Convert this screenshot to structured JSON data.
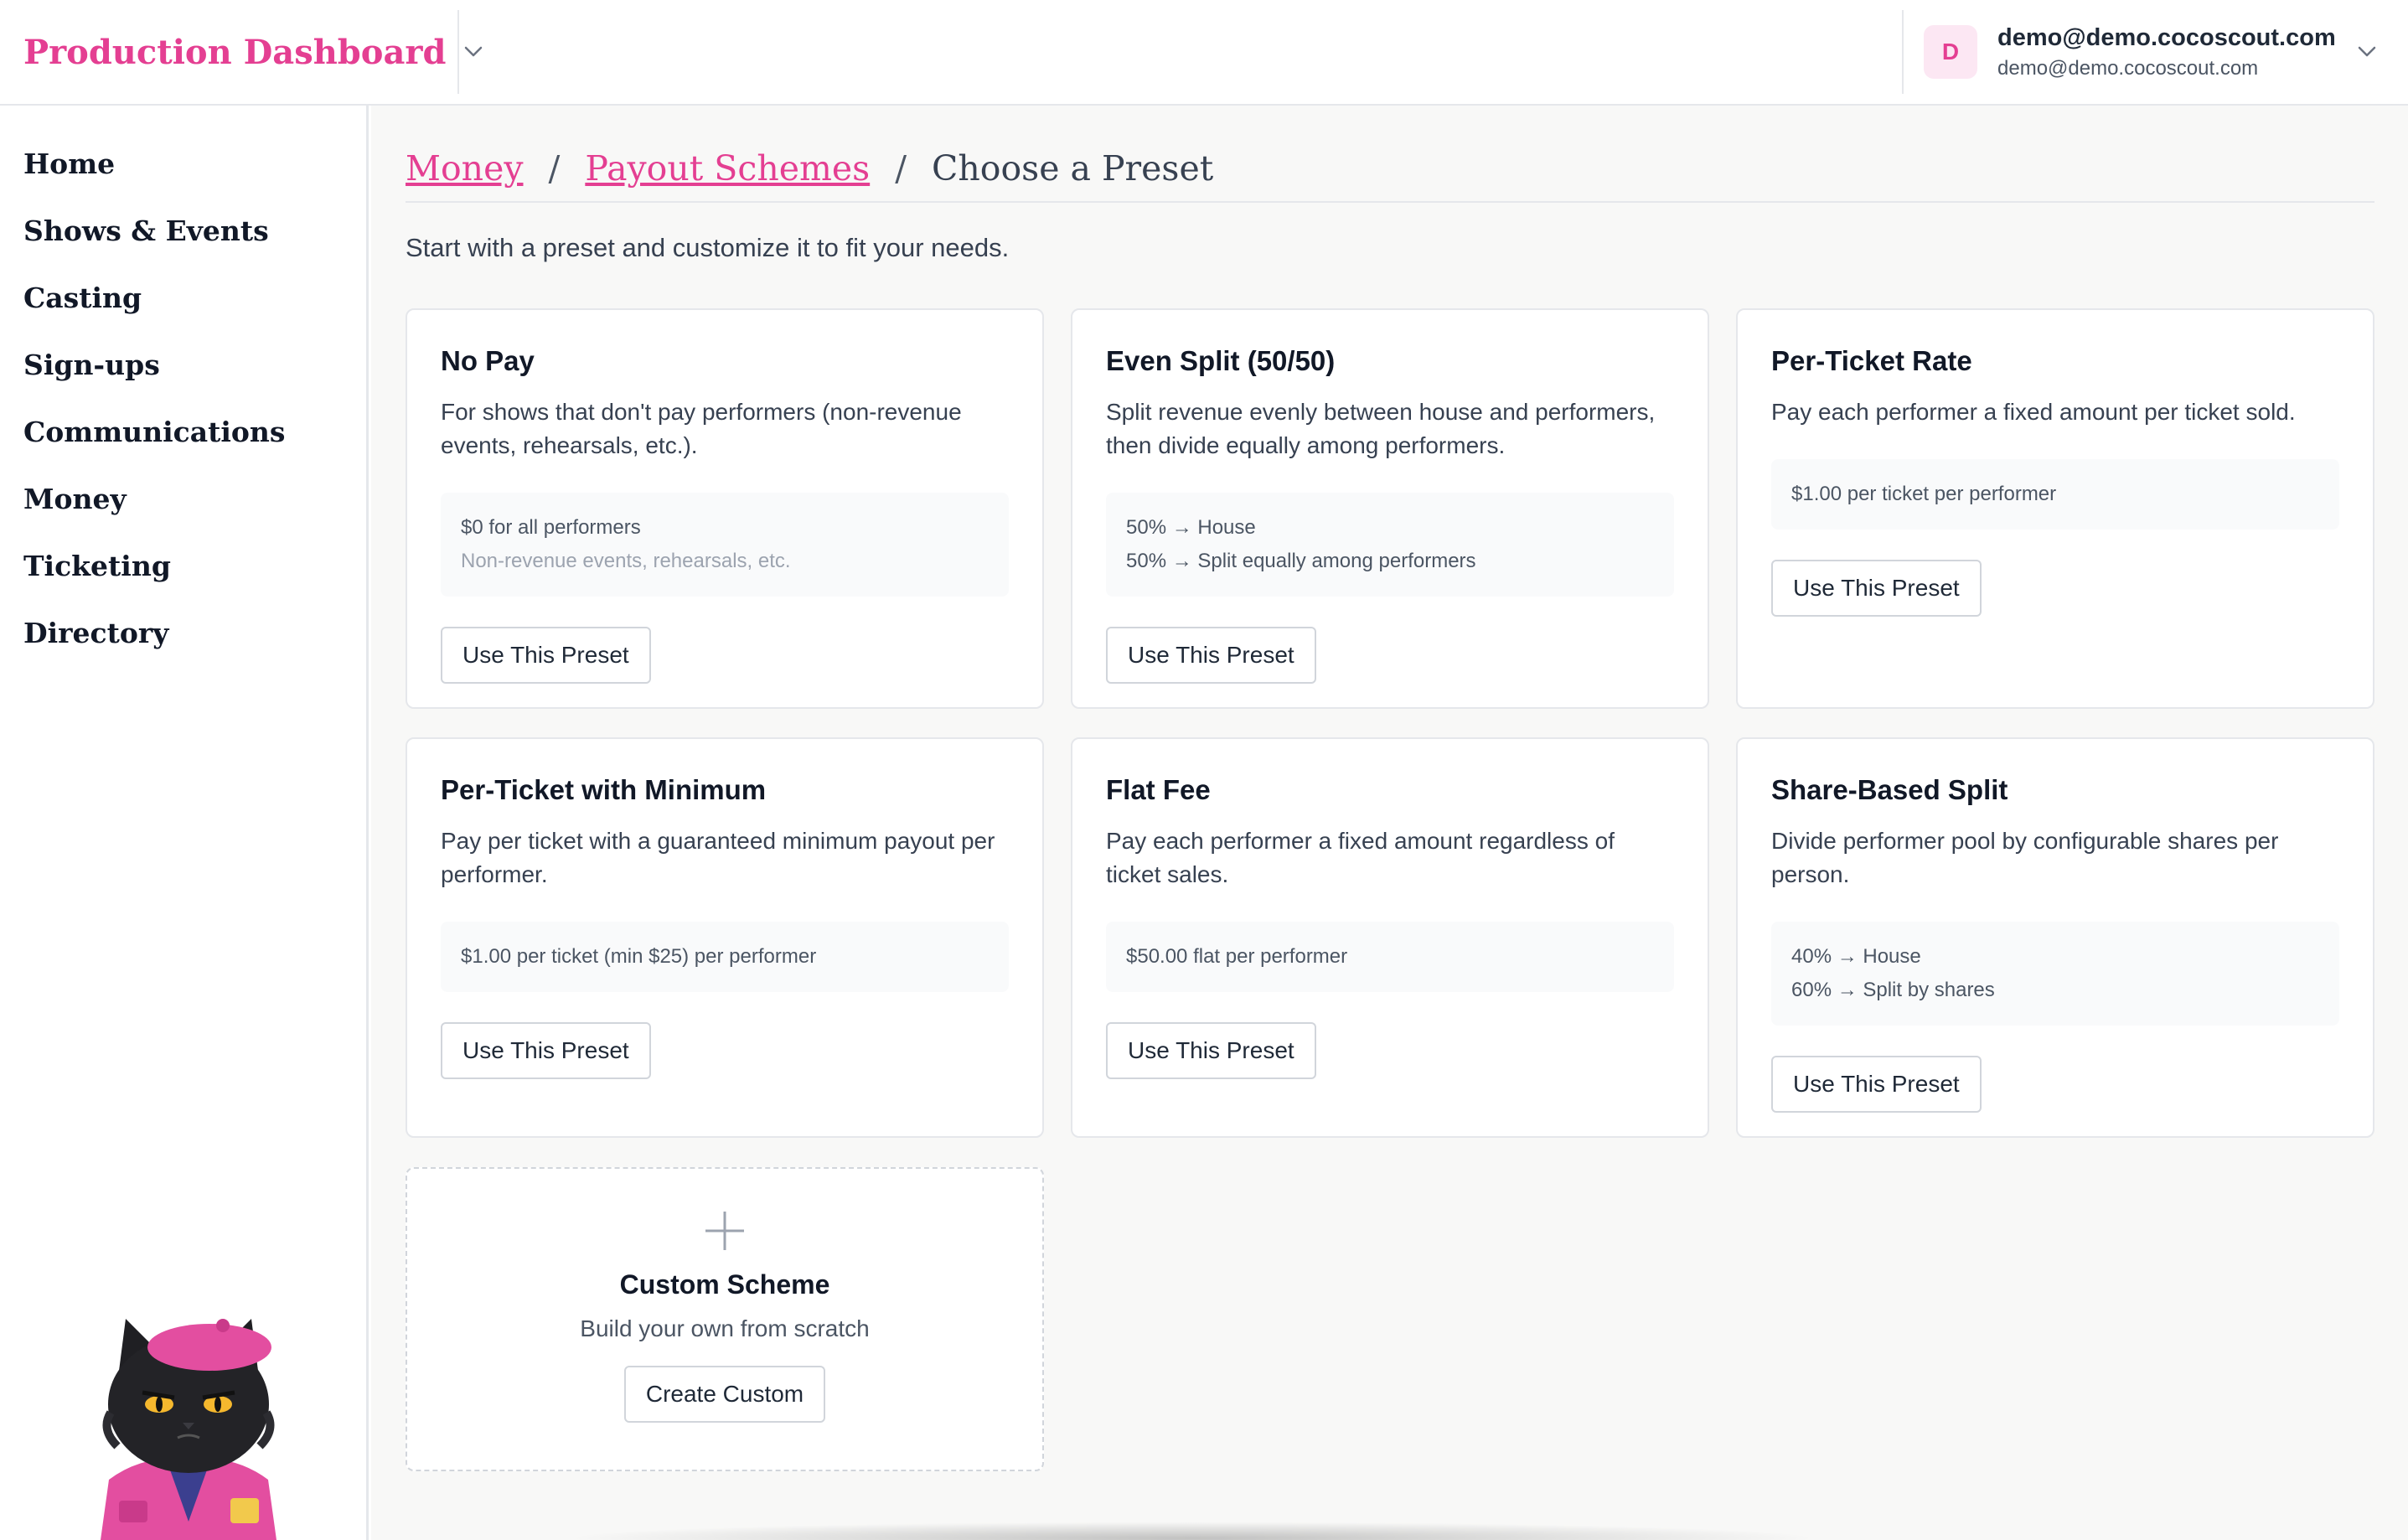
{
  "colors": {
    "brand": "#e43f92",
    "avatar_bg": "#fce7f3"
  },
  "header": {
    "brand_title": "Production Dashboard",
    "account": {
      "avatar_letter": "D",
      "name": "demo@demo.cocoscout.com",
      "email": "demo@demo.cocoscout.com"
    }
  },
  "sidebar": {
    "items": [
      {
        "label": "Home"
      },
      {
        "label": "Shows & Events"
      },
      {
        "label": "Casting"
      },
      {
        "label": "Sign-ups"
      },
      {
        "label": "Communications"
      },
      {
        "label": "Money"
      },
      {
        "label": "Ticketing"
      },
      {
        "label": "Directory"
      }
    ]
  },
  "breadcrumb": {
    "items": [
      {
        "label": "Money"
      },
      {
        "label": "Payout Schemes"
      }
    ],
    "separator": "/",
    "current": "Choose a Preset"
  },
  "intro": "Start with a preset and customize it to fit your needs.",
  "presets": [
    {
      "title": "No Pay",
      "description": "For shows that don't pay performers (non-revenue events, rehearsals, etc.).",
      "lines": [
        "$0 for all performers",
        "Non-revenue events, rehearsals, etc."
      ],
      "button": "Use This Preset"
    },
    {
      "title": "Even Split (50/50)",
      "description": "Split revenue evenly between house and performers, then divide equally among performers.",
      "lines": [
        "50% → House",
        "50% → Split equally among performers"
      ],
      "button": "Use This Preset"
    },
    {
      "title": "Per-Ticket Rate",
      "description": "Pay each performer a fixed amount per ticket sold.",
      "lines": [
        "$1.00 per ticket per performer"
      ],
      "button": "Use This Preset"
    },
    {
      "title": "Per-Ticket with Minimum",
      "description": "Pay per ticket with a guaranteed minimum payout per performer.",
      "lines": [
        "$1.00 per ticket (min $25) per performer"
      ],
      "button": "Use This Preset"
    },
    {
      "title": "Flat Fee",
      "description": "Pay each performer a fixed amount regardless of ticket sales.",
      "lines": [
        "$50.00 flat per performer"
      ],
      "button": "Use This Preset"
    },
    {
      "title": "Share-Based Split",
      "description": "Divide performer pool by configurable shares per person.",
      "lines": [
        "40% → House",
        "60% → Split by shares"
      ],
      "button": "Use This Preset"
    }
  ],
  "custom": {
    "icon": "plus-icon",
    "title": "Custom Scheme",
    "subtitle": "Build your own from scratch",
    "button": "Create Custom"
  }
}
